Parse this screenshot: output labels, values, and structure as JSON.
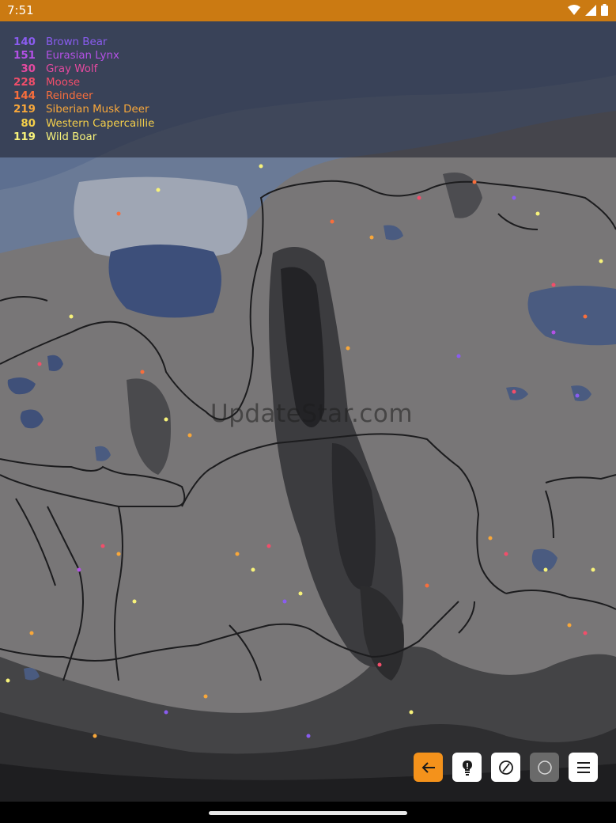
{
  "status_bar": {
    "time": "7:51",
    "icons": [
      "wifi-icon",
      "cell-signal-icon",
      "battery-icon"
    ]
  },
  "legend": {
    "items": [
      {
        "count": "140",
        "name": "Brown Bear",
        "color": "#8a5cf0"
      },
      {
        "count": "151",
        "name": "Eurasian Lynx",
        "color": "#b451e6"
      },
      {
        "count": "30",
        "name": "Gray Wolf",
        "color": "#e54aa0"
      },
      {
        "count": "228",
        "name": "Moose",
        "color": "#f24e6a"
      },
      {
        "count": "144",
        "name": "Reindeer",
        "color": "#f86e3c"
      },
      {
        "count": "219",
        "name": "Siberian Musk Deer",
        "color": "#f8a73a"
      },
      {
        "count": "80",
        "name": "Western Capercaillie",
        "color": "#f4cf4a"
      },
      {
        "count": "119",
        "name": "Wild Boar",
        "color": "#f7f27a"
      }
    ]
  },
  "watermark": "UpdateStar.com",
  "toolbar": {
    "buttons": [
      {
        "name": "back-button",
        "icon": "arrow-left-icon"
      },
      {
        "name": "hint-button",
        "icon": "lightbulb-icon"
      },
      {
        "name": "compass-button",
        "icon": "compass-icon"
      },
      {
        "name": "circle-button",
        "icon": "circle-icon"
      },
      {
        "name": "menu-button",
        "icon": "hamburger-menu-icon"
      }
    ]
  }
}
